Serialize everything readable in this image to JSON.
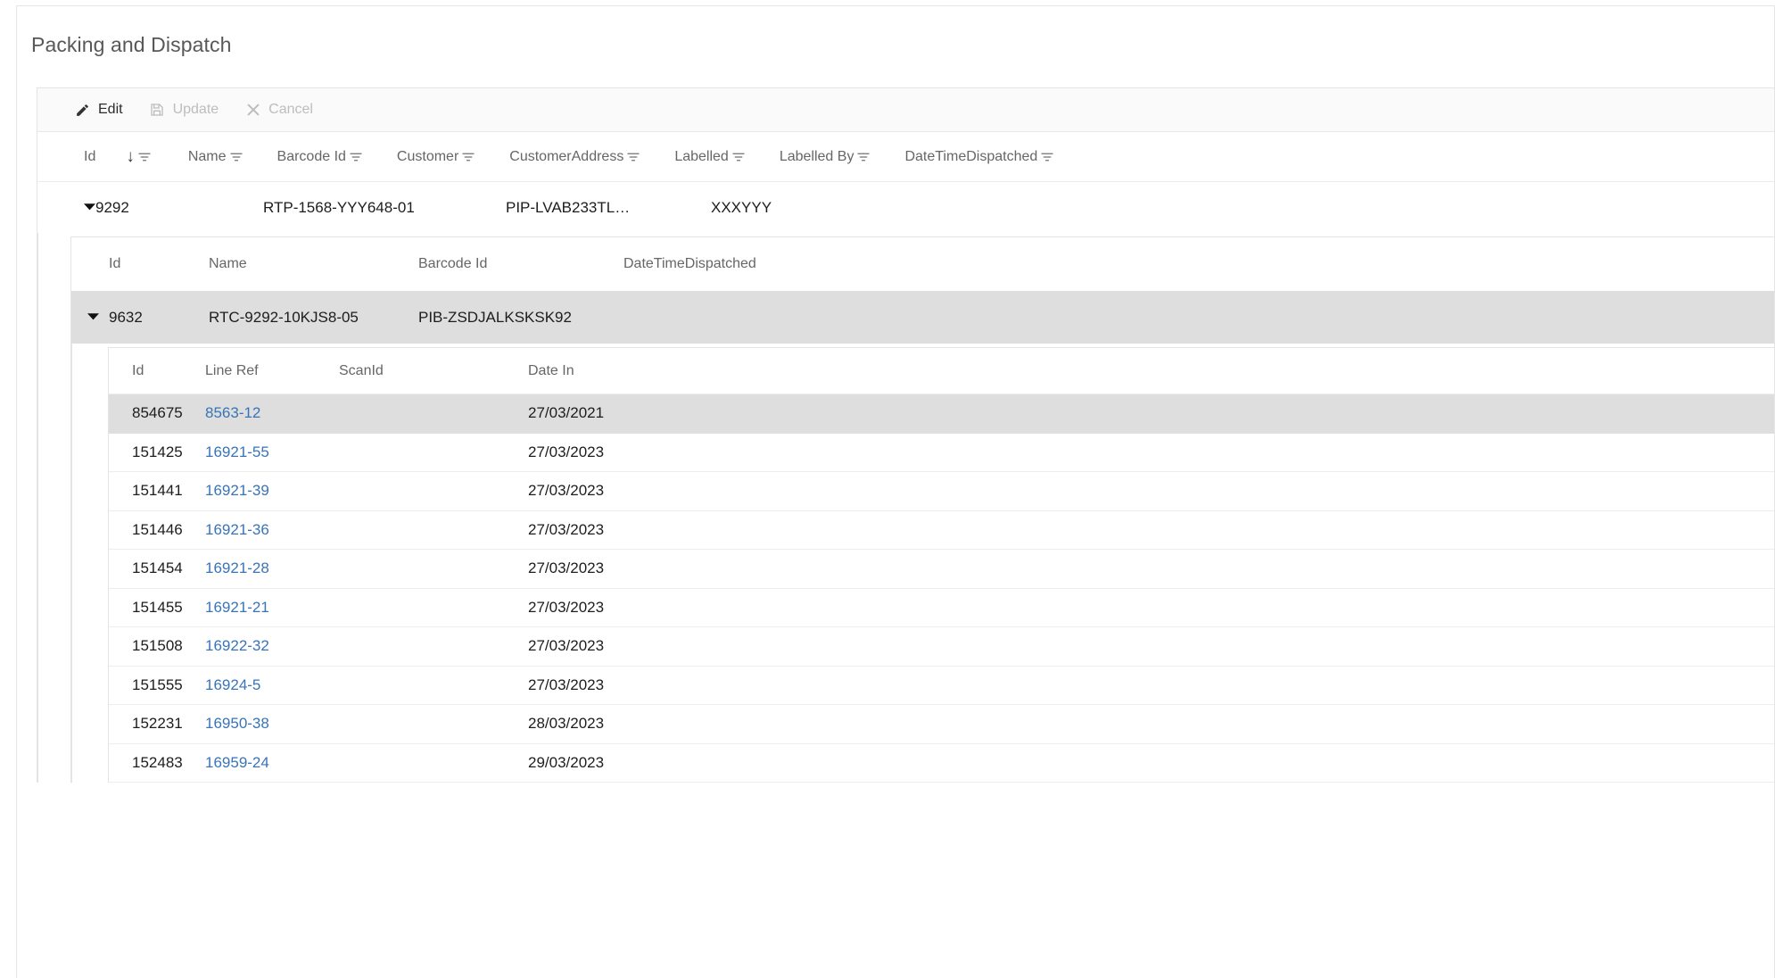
{
  "page": {
    "title": "Packing and Dispatch"
  },
  "toolbar": {
    "buttons": [
      {
        "label": "Edit",
        "icon": "pencil-icon",
        "enabled": true
      },
      {
        "label": "Update",
        "icon": "save-icon",
        "enabled": false
      },
      {
        "label": "Cancel",
        "icon": "close-icon",
        "enabled": false
      }
    ]
  },
  "grid_level1": {
    "columns": [
      {
        "label": "Id",
        "sorted": "descending",
        "filterable": true
      },
      {
        "label": "Name",
        "filterable": true
      },
      {
        "label": "Barcode Id",
        "filterable": true
      },
      {
        "label": "Customer",
        "filterable": true
      },
      {
        "label": "CustomerAddress",
        "filterable": true
      },
      {
        "label": "Labelled",
        "filterable": true
      },
      {
        "label": "Labelled By",
        "filterable": true
      },
      {
        "label": "DateTimeDispatched",
        "filterable": true
      }
    ],
    "rows": [
      {
        "expanded": true,
        "id": "9292",
        "name": "RTP-1568-YYY648-01",
        "barcode_id": "PIP-LVAB233TL…",
        "customer": "XXXYYY",
        "customer_address": "",
        "labelled": "",
        "labelled_by": "",
        "date_time_dispatched": ""
      }
    ]
  },
  "grid_level2": {
    "columns": [
      "Id",
      "Name",
      "Barcode Id",
      "DateTimeDispatched"
    ],
    "rows": [
      {
        "expanded": true,
        "selected": true,
        "id": "9632",
        "name": "RTC-9292-10KJS8-05",
        "barcode_id": "PIB-ZSDJALKSKSK92",
        "date_time_dispatched": ""
      }
    ]
  },
  "grid_level3": {
    "columns": [
      "Id",
      "Line Ref",
      "ScanId",
      "Date In"
    ],
    "rows": [
      {
        "id": "854675",
        "line_ref": "8563-12",
        "scan_id": "",
        "date_in": "27/03/2021",
        "selected": true
      },
      {
        "id": "151425",
        "line_ref": "16921-55",
        "scan_id": "",
        "date_in": "27/03/2023",
        "selected": false
      },
      {
        "id": "151441",
        "line_ref": "16921-39",
        "scan_id": "",
        "date_in": "27/03/2023",
        "selected": false
      },
      {
        "id": "151446",
        "line_ref": "16921-36",
        "scan_id": "",
        "date_in": "27/03/2023",
        "selected": false
      },
      {
        "id": "151454",
        "line_ref": "16921-28",
        "scan_id": "",
        "date_in": "27/03/2023",
        "selected": false
      },
      {
        "id": "151455",
        "line_ref": "16921-21",
        "scan_id": "",
        "date_in": "27/03/2023",
        "selected": false
      },
      {
        "id": "151508",
        "line_ref": "16922-32",
        "scan_id": "",
        "date_in": "27/03/2023",
        "selected": false
      },
      {
        "id": "151555",
        "line_ref": "16924-5",
        "scan_id": "",
        "date_in": "27/03/2023",
        "selected": false
      },
      {
        "id": "152231",
        "line_ref": "16950-38",
        "scan_id": "",
        "date_in": "28/03/2023",
        "selected": false
      },
      {
        "id": "152483",
        "line_ref": "16959-24",
        "scan_id": "",
        "date_in": "29/03/2023",
        "selected": false
      }
    ]
  },
  "colors": {
    "link": "#3874b8",
    "selected_row": "#dedede",
    "toolbar_bg": "#fafafa",
    "header_text": "#666666",
    "disabled_text": "#bdbdbd"
  }
}
